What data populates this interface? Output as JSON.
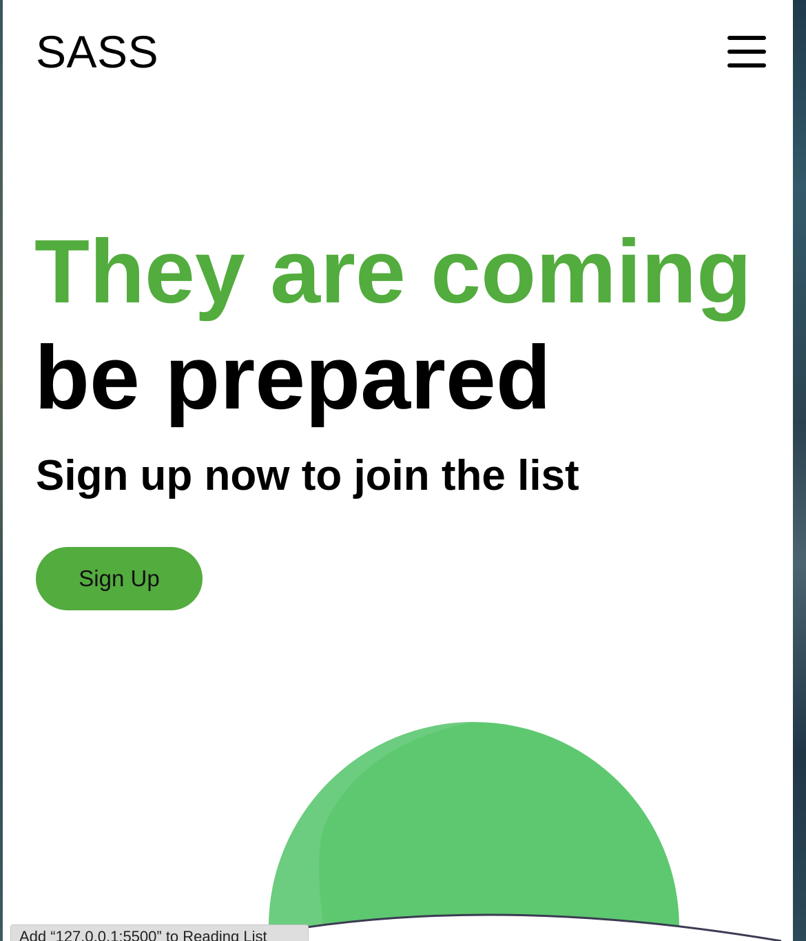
{
  "header": {
    "logo": "SASS",
    "menu_icon": "hamburger-menu-icon"
  },
  "hero": {
    "headline_line1": "They are coming",
    "headline_line2": "be prepared",
    "subheadline": "Sign up now to join the list",
    "cta_label": "Sign Up"
  },
  "status_bar": {
    "tooltip": "Add “127.0.0.1:5500” to Reading List"
  },
  "colors": {
    "accent": "#53ac3e",
    "blob_main": "#5ec870",
    "blob_highlight": "#6ccc7f",
    "page_background": "#ffffff",
    "text": "#000000"
  }
}
